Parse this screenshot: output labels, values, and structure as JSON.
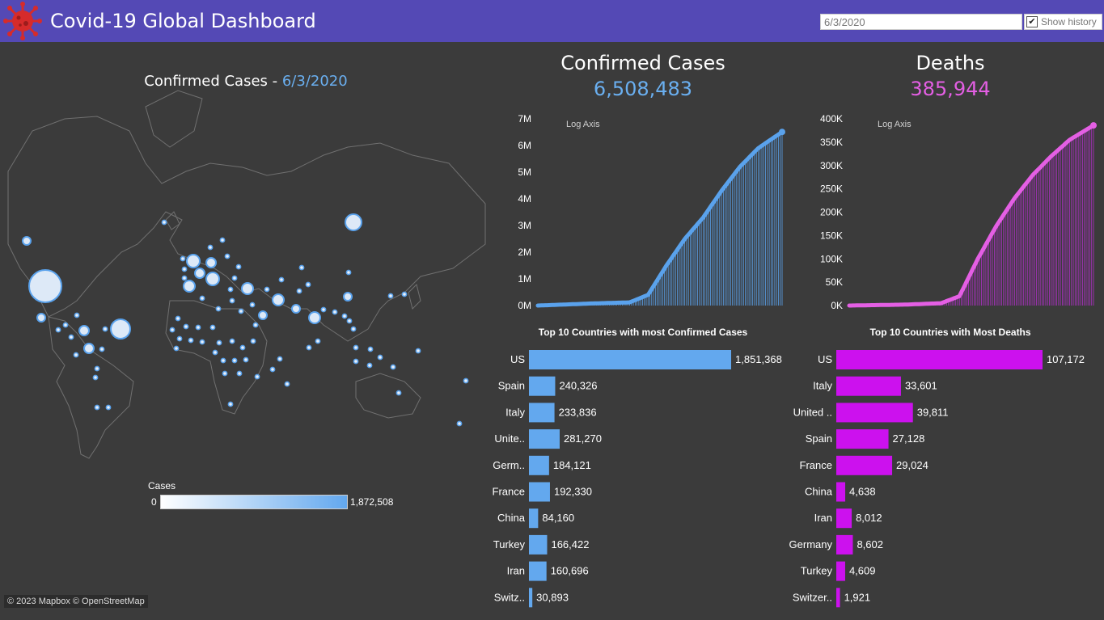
{
  "header": {
    "title": "Covid-19 Global Dashboard",
    "date_value": "6/3/2020",
    "show_history_label": "Show history",
    "show_history_checked": true
  },
  "map": {
    "title": "Confirmed Cases",
    "separator": " - ",
    "date": "6/3/2020",
    "legend_title": "Cases",
    "legend_min": "0",
    "legend_max": "1,872,508",
    "attribution": "© 2023 Mapbox © OpenStreetMap"
  },
  "kpis": {
    "confirmed": {
      "label": "Confirmed Cases",
      "value": "6,508,483",
      "color": "#6aaff0"
    },
    "deaths": {
      "label": "Deaths",
      "value": "385,944",
      "color": "#e45fe4"
    }
  },
  "colors": {
    "header_bg": "#5449b5",
    "background": "#3b3b3b",
    "confirmed": "#5aa2ec",
    "deaths": "#cc11ee",
    "deaths_line": "#e45fe4"
  },
  "chart_data": [
    {
      "type": "area",
      "title": "",
      "annotation": "Log Axis",
      "ylim": [
        0,
        7000000
      ],
      "yticks": [
        "0M",
        "1M",
        "2M",
        "3M",
        "4M",
        "5M",
        "6M",
        "7M"
      ],
      "yticks_values": [
        0,
        1000000,
        2000000,
        3000000,
        4000000,
        5000000,
        6000000,
        7000000
      ],
      "x_start": "1/22/2020",
      "x_end": "6/3/2020",
      "points": [
        [
          0,
          0
        ],
        [
          30,
          80000
        ],
        [
          50,
          120000
        ],
        [
          60,
          400000
        ],
        [
          70,
          1500000
        ],
        [
          80,
          2500000
        ],
        [
          90,
          3300000
        ],
        [
          100,
          4300000
        ],
        [
          110,
          5200000
        ],
        [
          120,
          5900000
        ],
        [
          133,
          6508483
        ]
      ]
    },
    {
      "type": "area",
      "title": "",
      "annotation": "Log Axis",
      "ylim": [
        0,
        400000
      ],
      "yticks": [
        "0K",
        "50K",
        "100K",
        "150K",
        "200K",
        "250K",
        "300K",
        "350K",
        "400K"
      ],
      "yticks_values": [
        0,
        50000,
        100000,
        150000,
        200000,
        250000,
        300000,
        350000,
        400000
      ],
      "x_start": "1/22/2020",
      "x_end": "6/3/2020",
      "points": [
        [
          0,
          0
        ],
        [
          30,
          2000
        ],
        [
          50,
          5000
        ],
        [
          60,
          20000
        ],
        [
          70,
          100000
        ],
        [
          80,
          170000
        ],
        [
          90,
          230000
        ],
        [
          100,
          280000
        ],
        [
          110,
          320000
        ],
        [
          120,
          355000
        ],
        [
          133,
          385944
        ]
      ]
    },
    {
      "type": "bar",
      "title": "Top 10 Countries with most Confirmed Cases",
      "categories": [
        "US",
        "Spain",
        "Italy",
        "Unite..",
        "Germ..",
        "France",
        "China",
        "Turkey",
        "Iran",
        "Switz.."
      ],
      "values": [
        1851368,
        240326,
        233836,
        281270,
        184121,
        192330,
        84160,
        166422,
        160696,
        30893
      ],
      "labels": [
        "1,851,368",
        "240,326",
        "233,836",
        "281,270",
        "184,121",
        "192,330",
        "84,160",
        "166,422",
        "160,696",
        "30,893"
      ]
    },
    {
      "type": "bar",
      "title": "Top 10 Countries with Most Deaths",
      "categories": [
        "US",
        "Italy",
        "United ..",
        "Spain",
        "France",
        "China",
        "Iran",
        "Germany",
        "Turkey",
        "Switzer.."
      ],
      "values": [
        107172,
        33601,
        39811,
        27128,
        29024,
        4638,
        8012,
        8602,
        4609,
        1921
      ],
      "labels": [
        "107,172",
        "33,601",
        "39,811",
        "27,128",
        "29,024",
        "4,638",
        "8,012",
        "8,602",
        "4,609",
        "1,921"
      ]
    }
  ]
}
